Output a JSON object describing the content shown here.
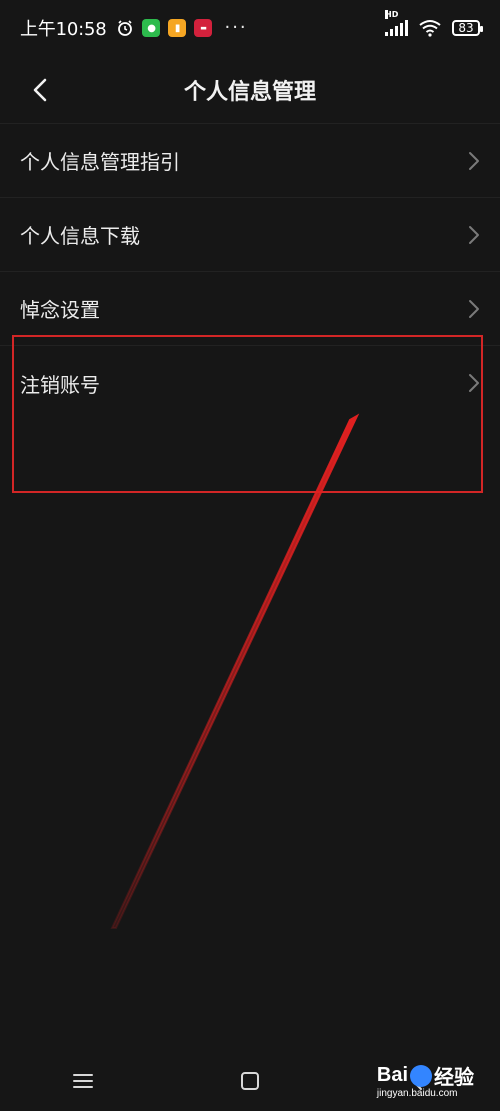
{
  "status_bar": {
    "time": "上午10:58",
    "more_dots": "···",
    "network_label": "HD",
    "battery": "83"
  },
  "header": {
    "title": "个人信息管理"
  },
  "menu": {
    "items": [
      {
        "label": "个人信息管理指引"
      },
      {
        "label": "个人信息下载"
      },
      {
        "label": "悼念设置"
      },
      {
        "label": "注销账号"
      }
    ]
  },
  "nav": {
    "menu_icon": "menu-icon",
    "home_icon": "home-icon",
    "back_icon": "back-icon"
  },
  "watermark": {
    "brand": "Bai",
    "brand_suffix": "经验",
    "url": "jingyan.baidu.com"
  },
  "colors": {
    "background": "#161616",
    "text": "#ececec",
    "highlight": "#d32626",
    "chevron": "#7a7a7a"
  }
}
